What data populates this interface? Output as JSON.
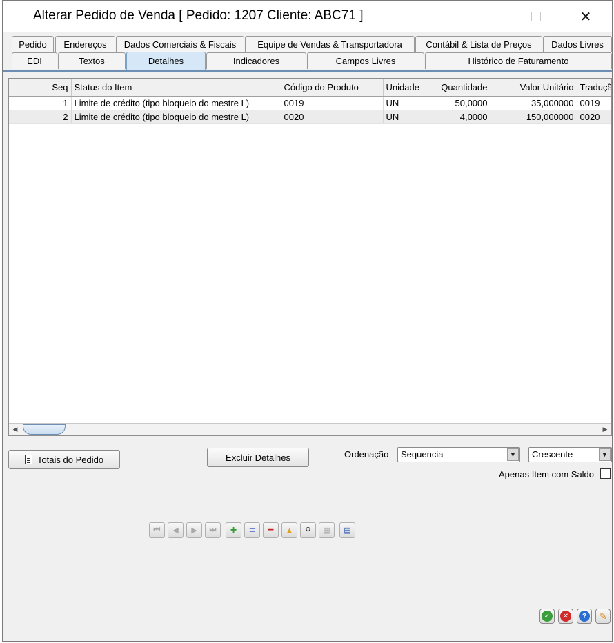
{
  "window": {
    "title": "Alterar Pedido de Venda [ Pedido: 1207 Cliente: ABC71 ]",
    "minimize_glyph": "—",
    "close_glyph": "✕"
  },
  "tabs_row1": [
    "Pedido",
    "Endereços",
    "Dados Comerciais & Fiscais",
    "Equipe de Vendas & Transportadora",
    "Contábil & Lista de Preços",
    "Dados Livres"
  ],
  "tabs_row2": [
    "EDI",
    "Textos",
    "Detalhes",
    "Indicadores",
    "Campos Livres",
    "Histórico de Faturamento"
  ],
  "active_tab": "Detalhes",
  "grid": {
    "columns": [
      "Seq",
      "Status do Item",
      "Código do Produto",
      "Unidade",
      "Quantidade",
      "Valor Unitário",
      "Tradução"
    ],
    "rows": [
      [
        "1",
        "Limite de crédito (tipo bloqueio do mestre L)",
        "0019",
        "UN",
        "50,0000",
        "35,000000",
        "0019"
      ],
      [
        "2",
        "Limite de crédito (tipo bloqueio do mestre L)",
        "0020",
        "UN",
        "4,0000",
        "150,000000",
        "0020"
      ]
    ]
  },
  "buttons": {
    "totais": "Totais do Pedido",
    "excluir": "Excluir Detalhes"
  },
  "ordenacao": {
    "label": "Ordenação",
    "field_value": "Sequencia",
    "direction_value": "Crescente"
  },
  "apenas_item": {
    "label": "Apenas Item com Saldo",
    "checked": false
  },
  "icons": {
    "navigator": [
      "first-record-icon",
      "prev-record-icon",
      "next-record-icon",
      "last-record-icon",
      "add-record-icon",
      "edit-record-icon",
      "delete-record-icon",
      "up-icon",
      "search-icon",
      "grid-view-icon",
      "form-view-icon"
    ],
    "actions": [
      "ok-icon",
      "cancel-icon",
      "help-icon",
      "settings-wrench-icon"
    ]
  },
  "colors": {
    "active_tab": "#d6e8f7",
    "tab_border_line": "#6d8fb3",
    "ok": "#3a9e3a",
    "cancel": "#d02a2a",
    "help": "#2a6fd0",
    "wrench": "#e08a1a"
  }
}
